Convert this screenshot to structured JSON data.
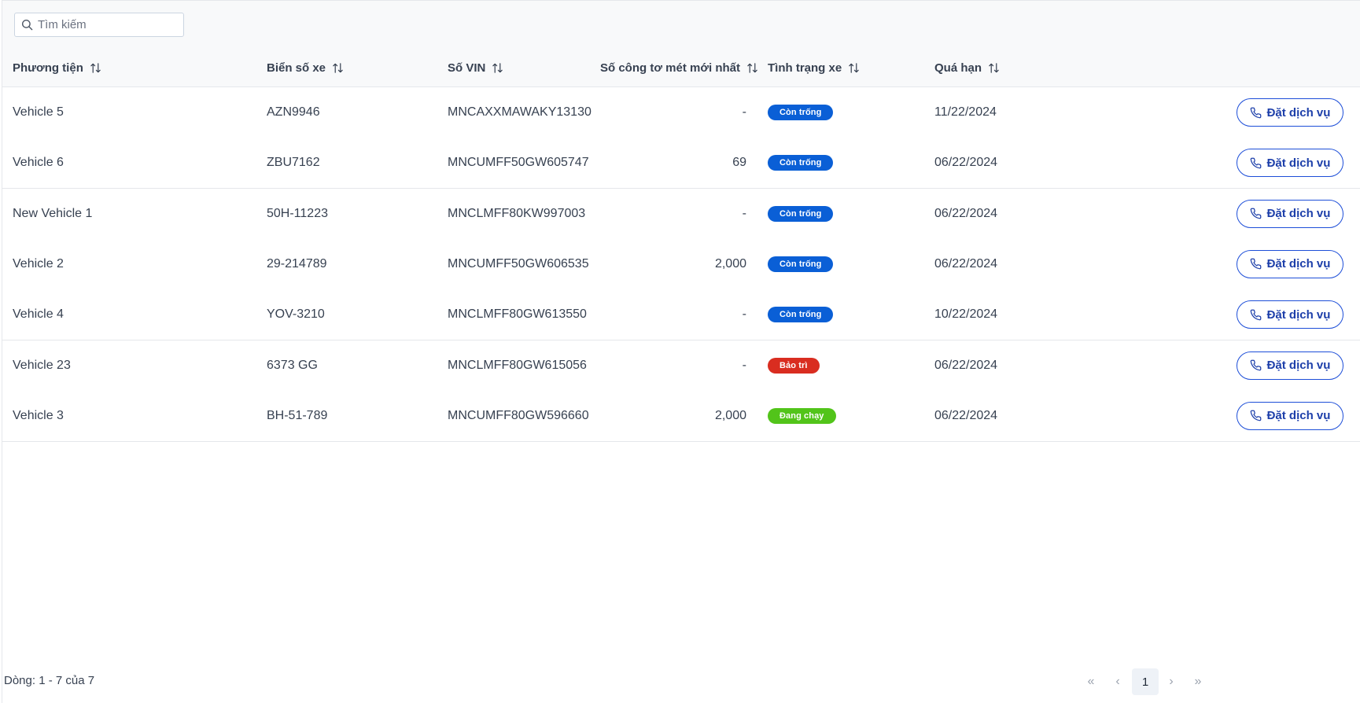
{
  "search": {
    "placeholder": "Tìm kiếm",
    "value": "",
    "icon": "search-icon"
  },
  "columns": [
    {
      "label": "Phương tiện"
    },
    {
      "label": "Biển số xe"
    },
    {
      "label": "Số VIN"
    },
    {
      "label": "Số công tơ mét mới nhất"
    },
    {
      "label": "Tình trạng xe"
    },
    {
      "label": "Quá hạn"
    }
  ],
  "rows": [
    {
      "vehicle": "Vehicle 5",
      "plate": "AZN9946",
      "vin": "MNCAXXMAWAKY13130",
      "odometer": "-",
      "status": "Còn trống",
      "status_color": "#0a5fd6",
      "due": "11/22/2024",
      "action": "Đặt dịch vụ"
    },
    {
      "vehicle": "Vehicle 6",
      "plate": "ZBU7162",
      "vin": "MNCUMFF50GW605747",
      "odometer": "69",
      "status": "Còn trống",
      "status_color": "#0a5fd6",
      "due": "06/22/2024",
      "action": "Đặt dịch vụ"
    },
    {
      "vehicle": "New Vehicle 1",
      "plate": "50H-11223",
      "vin": "MNCLMFF80KW997003",
      "odometer": "-",
      "status": "Còn trống",
      "status_color": "#0a5fd6",
      "due": "06/22/2024",
      "action": "Đặt dịch vụ"
    },
    {
      "vehicle": "Vehicle 2",
      "plate": "29-214789",
      "vin": "MNCUMFF50GW606535",
      "odometer": "2,000",
      "status": "Còn trống",
      "status_color": "#0a5fd6",
      "due": "06/22/2024",
      "action": "Đặt dịch vụ"
    },
    {
      "vehicle": "Vehicle 4",
      "plate": "YOV-3210",
      "vin": "MNCLMFF80GW613550",
      "odometer": "-",
      "status": "Còn trống",
      "status_color": "#0a5fd6",
      "due": "10/22/2024",
      "action": "Đặt dịch vụ"
    },
    {
      "vehicle": "Vehicle 23",
      "plate": "6373 GG",
      "vin": "MNCLMFF80GW615056",
      "odometer": "-",
      "status": "Bảo trì",
      "status_color": "#d92d20",
      "due": "06/22/2024",
      "action": "Đặt dịch vụ"
    },
    {
      "vehicle": "Vehicle 3",
      "plate": "BH-51-789",
      "vin": "MNCUMFF80GW596660",
      "odometer": "2,000",
      "status": "Đang chạy",
      "status_color": "#52c41a",
      "due": "06/22/2024",
      "action": "Đặt dịch vụ"
    }
  ],
  "footer": {
    "rows_info": "Dòng: 1 - 7 của 7"
  },
  "pagination": {
    "first": "«",
    "prev": "‹",
    "current": "1",
    "next": "›",
    "last": "»"
  },
  "colors": {
    "accent": "#1d4ed8",
    "header_bg": "#f8f9fa",
    "border": "#e5e7eb"
  }
}
